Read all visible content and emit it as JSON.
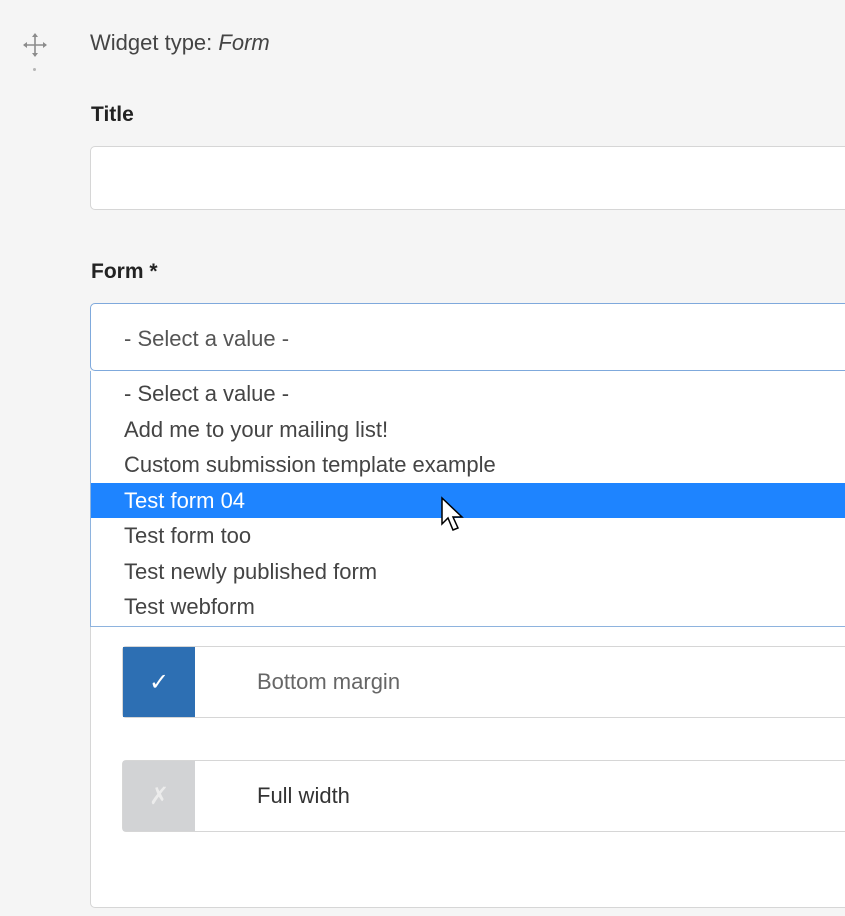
{
  "header": {
    "widget_type_label": "Widget type:",
    "widget_type_value": "Form",
    "drag_icon": "move-icon"
  },
  "title_field": {
    "label": "Title",
    "value": "",
    "placeholder": ""
  },
  "form_field": {
    "label": "Form *",
    "selected_value": "- Select a value -",
    "options": [
      "- Select a value -",
      "Add me to your mailing list!",
      "Custom submission template example",
      "Test form 04",
      "Test form too",
      "Test newly published form",
      "Test webform"
    ],
    "highlighted_option": "Test form 04"
  },
  "toggles": {
    "bottom_margin": {
      "label": "Bottom margin",
      "checked": true,
      "icon": "check-icon",
      "glyph": "✓"
    },
    "full_width": {
      "label": "Full width",
      "checked": false,
      "icon": "x-icon",
      "glyph": "✗"
    }
  },
  "colors": {
    "highlight": "#1e84ff",
    "toggle_on": "#2d6fb3",
    "toggle_off": "#d2d3d5"
  }
}
